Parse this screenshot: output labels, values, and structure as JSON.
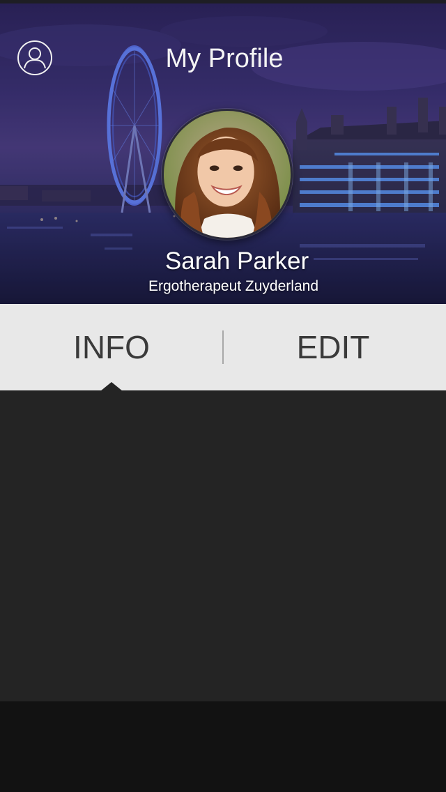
{
  "header": {
    "title": "My Profile",
    "profile_icon": "user-outline-icon"
  },
  "profile": {
    "name": "Sarah Parker",
    "subtitle": "Ergotherapeut Zuyderland"
  },
  "tabs": [
    {
      "label": "INFO",
      "active": true
    },
    {
      "label": "EDIT",
      "active": false
    }
  ],
  "colors": {
    "tab_background": "#e8e8e8",
    "tab_text": "#3a3a3a",
    "content_background": "#242424",
    "footer_background": "#121212"
  }
}
